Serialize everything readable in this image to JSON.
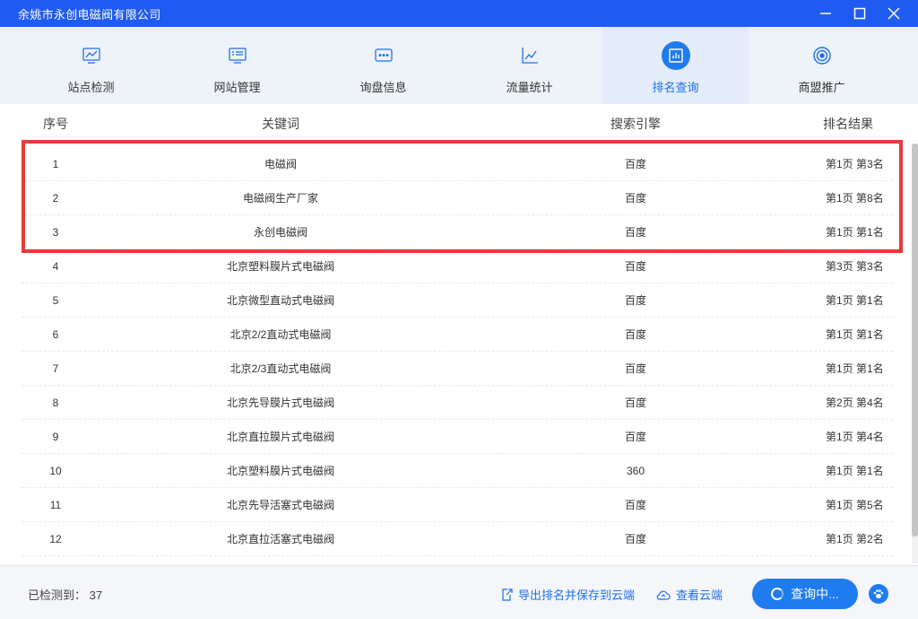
{
  "window": {
    "title": "余姚市永创电磁阀有限公司"
  },
  "nav": {
    "tabs": [
      {
        "label": "站点检测",
        "icon": "monitor-chart-icon"
      },
      {
        "label": "网站管理",
        "icon": "web-admin-icon"
      },
      {
        "label": "询盘信息",
        "icon": "message-dots-icon"
      },
      {
        "label": "流量统计",
        "icon": "line-chart-icon"
      },
      {
        "label": "排名查询",
        "icon": "bar-chart-icon",
        "active": true
      },
      {
        "label": "商盟推广",
        "icon": "target-icon"
      }
    ]
  },
  "table": {
    "headers": {
      "index": "序号",
      "keyword": "关键词",
      "engine": "搜索引擎",
      "result": "排名结果"
    },
    "rows": [
      {
        "index": "1",
        "keyword": "电磁阀",
        "engine": "百度",
        "result": "第1页 第3名"
      },
      {
        "index": "2",
        "keyword": "电磁阀生产厂家",
        "engine": "百度",
        "result": "第1页 第8名"
      },
      {
        "index": "3",
        "keyword": "永创电磁阀",
        "engine": "百度",
        "result": "第1页 第1名"
      },
      {
        "index": "4",
        "keyword": "北京塑料膜片式电磁阀",
        "engine": "百度",
        "result": "第3页 第3名"
      },
      {
        "index": "5",
        "keyword": "北京微型直动式电磁阀",
        "engine": "百度",
        "result": "第1页 第1名"
      },
      {
        "index": "6",
        "keyword": "北京2/2直动式电磁阀",
        "engine": "百度",
        "result": "第1页 第1名"
      },
      {
        "index": "7",
        "keyword": "北京2/3直动式电磁阀",
        "engine": "百度",
        "result": "第1页 第1名"
      },
      {
        "index": "8",
        "keyword": "北京先导膜片式电磁阀",
        "engine": "百度",
        "result": "第2页 第4名"
      },
      {
        "index": "9",
        "keyword": "北京直拉膜片式电磁阀",
        "engine": "百度",
        "result": "第1页 第4名"
      },
      {
        "index": "10",
        "keyword": "北京塑料膜片式电磁阀",
        "engine": "360",
        "result": "第1页 第1名"
      },
      {
        "index": "11",
        "keyword": "北京先导活塞式电磁阀",
        "engine": "百度",
        "result": "第1页 第5名"
      },
      {
        "index": "12",
        "keyword": "北京直拉活塞式电磁阀",
        "engine": "百度",
        "result": "第1页 第2名"
      }
    ]
  },
  "footer": {
    "detected_label": "已检测到：",
    "detected_count": "37",
    "export_label": "导出排名并保存到云端",
    "view_cloud_label": "查看云端",
    "query_label": "查询中..."
  },
  "colors": {
    "accent": "#1f5bf0",
    "highlight": "#e8383b"
  }
}
